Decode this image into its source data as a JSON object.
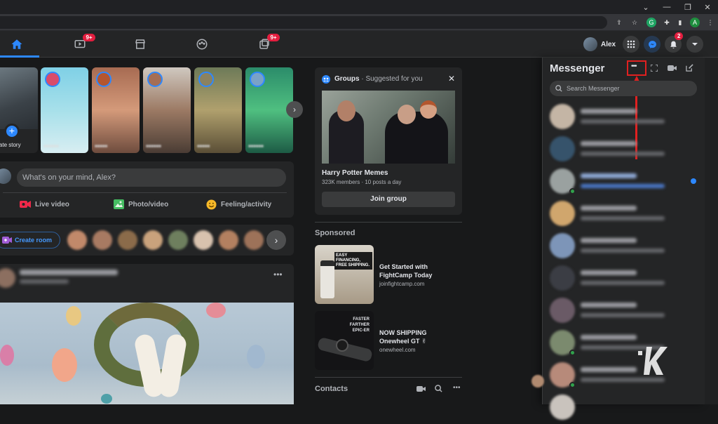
{
  "browser": {
    "profile_initial": "A"
  },
  "nav": {
    "watch_badge": "9+",
    "gaming_badge": "9+",
    "user_name": "Alex",
    "notifications_badge": "2"
  },
  "stories": {
    "create_label": "Create story"
  },
  "composer": {
    "placeholder": "What's on your mind, Alex?",
    "live_video": "Live video",
    "photo_video": "Photo/video",
    "feeling_activity": "Feeling/activity"
  },
  "rooms": {
    "create_room": "Create room"
  },
  "groups": {
    "heading": "Groups",
    "subheading": "· Suggested for you",
    "group_name": "Harry Potter Memes",
    "group_meta": "323K members · 10 posts a day",
    "join_label": "Join group"
  },
  "sponsored": {
    "heading": "Sponsored",
    "ads": [
      {
        "title": "Get Started with FightCamp Today",
        "domain": "joinfightcamp.com",
        "image_text": "EASY FINANCING, FREE SHIPPING."
      },
      {
        "title": "NOW SHIPPING Onewheel GT ✌",
        "domain": "onewheel.com",
        "image_text": "FASTER FARTHER EPIC-ER"
      }
    ]
  },
  "contacts": {
    "heading": "Contacts"
  },
  "messenger": {
    "title": "Messenger",
    "search_placeholder": "Search Messenger"
  },
  "colors": {
    "accent": "#2d88ff",
    "badge": "#e41e3f",
    "highlight": "#e02020",
    "online": "#31a24c"
  }
}
